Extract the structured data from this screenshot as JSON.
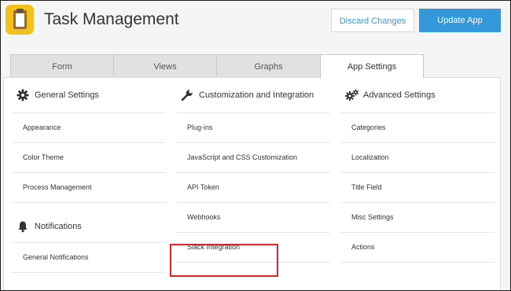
{
  "header": {
    "app_title": "Task Management",
    "discard_label": "Discard Changes",
    "update_label": "Update App"
  },
  "tabs": [
    {
      "label": "Form"
    },
    {
      "label": "Views"
    },
    {
      "label": "Graphs"
    },
    {
      "label": "App Settings",
      "active": true
    }
  ],
  "sections": {
    "general": {
      "heading": "General Settings",
      "icon": "gear-icon",
      "items": [
        "Appearance",
        "Color Theme",
        "Process Management"
      ]
    },
    "notifications": {
      "heading": "Notifications",
      "icon": "bell-icon",
      "items": [
        "General Notifications"
      ]
    },
    "customization": {
      "heading": "Customization and Integration",
      "icon": "wrench-icon",
      "items": [
        "Plug-ins",
        "JavaScript and CSS Customization",
        "API Token",
        "Webhooks",
        "Slack Integration"
      ]
    },
    "advanced": {
      "heading": "Advanced Settings",
      "icon": "gears-icon",
      "items": [
        "Categories",
        "Localization",
        "Title Field",
        "Misc Settings",
        "Actions"
      ]
    }
  },
  "colors": {
    "accent": "#3498db",
    "highlight_box": "#e0212a",
    "app_icon": "#f3c11b"
  }
}
